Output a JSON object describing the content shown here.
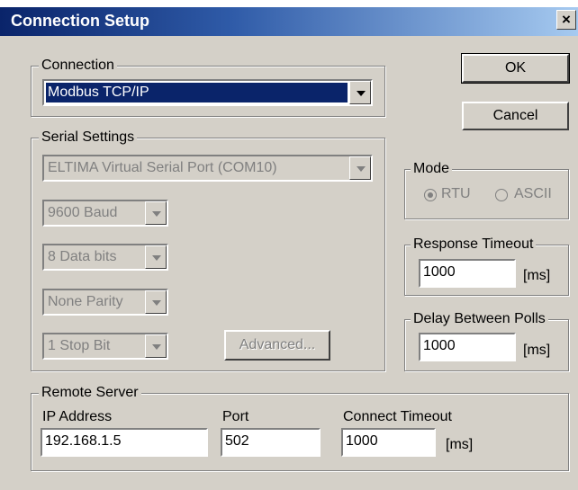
{
  "window": {
    "title": "Connection Setup",
    "close_glyph": "×"
  },
  "buttons": {
    "ok": "OK",
    "cancel": "Cancel",
    "advanced": "Advanced..."
  },
  "connection": {
    "legend": "Connection",
    "selected": "Modbus TCP/IP"
  },
  "serial": {
    "legend": "Serial Settings",
    "port": "ELTIMA Virtual Serial Port (COM10)",
    "baud": "9600 Baud",
    "data_bits": "8 Data bits",
    "parity": "None Parity",
    "stop_bits": "1 Stop Bit"
  },
  "mode": {
    "legend": "Mode",
    "rtu": "RTU",
    "ascii": "ASCII",
    "selected": "RTU"
  },
  "response_timeout": {
    "legend": "Response Timeout",
    "value": "1000",
    "unit": "[ms]"
  },
  "delay_between_polls": {
    "legend": "Delay Between Polls",
    "value": "1000",
    "unit": "[ms]"
  },
  "remote_server": {
    "legend": "Remote Server",
    "ip_label": "IP Address",
    "ip_value": "192.168.1.5",
    "port_label": "Port",
    "port_value": "502",
    "connect_timeout_label": "Connect Timeout",
    "connect_timeout_value": "1000",
    "unit": "[ms]"
  },
  "colors": {
    "title_start": "#0a246a",
    "title_end": "#a6caf0",
    "face": "#d4d0c8",
    "selection": "#0a246a"
  }
}
